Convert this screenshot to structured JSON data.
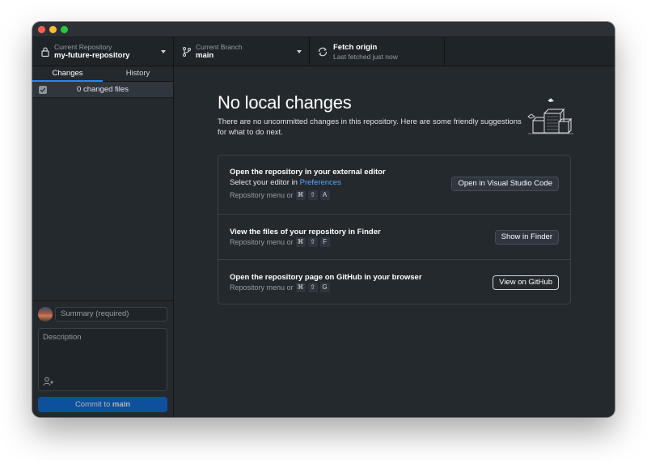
{
  "toolbar": {
    "repo_label": "Current Repository",
    "repo_value": "my-future-repository",
    "branch_label": "Current Branch",
    "branch_value": "main",
    "fetch_title": "Fetch origin",
    "fetch_sub": "Last fetched just now"
  },
  "sidebar": {
    "tabs": [
      {
        "label": "Changes",
        "active": true
      },
      {
        "label": "History",
        "active": false
      }
    ],
    "changed_files": "0 changed files"
  },
  "commit": {
    "summary_placeholder": "Summary (required)",
    "description_placeholder": "Description",
    "button_prefix": "Commit to ",
    "button_branch": "main"
  },
  "main": {
    "title": "No local changes",
    "subtitle": "There are no uncommitted changes in this repository. Here are some friendly suggestions for what to do next.",
    "actions": [
      {
        "title": "Open the repository in your external editor",
        "sub_prefix": "Select your editor in ",
        "sub_link": "Preferences",
        "shortcut_prefix": "Repository menu or",
        "keys": [
          "⌘",
          "⇧",
          "A"
        ],
        "button": "Open in Visual Studio Code"
      },
      {
        "title": "View the files of your repository in Finder",
        "shortcut_prefix": "Repository menu or",
        "keys": [
          "⌘",
          "⇧",
          "F"
        ],
        "button": "Show in Finder"
      },
      {
        "title": "Open the repository page on GitHub in your browser",
        "shortcut_prefix": "Repository menu or",
        "keys": [
          "⌘",
          "⇧",
          "G"
        ],
        "button": "View on GitHub"
      }
    ]
  },
  "colors": {
    "accent": "#2188ff",
    "commit_button": "#0366d6",
    "link": "#58a6ff",
    "background": "#24292e"
  },
  "icons": {
    "repo": "lock-icon",
    "branch": "git-branch-icon",
    "fetch": "sync-icon",
    "coauthor": "person-add-icon",
    "illustration": "empty-boxes-illustration-icon"
  }
}
